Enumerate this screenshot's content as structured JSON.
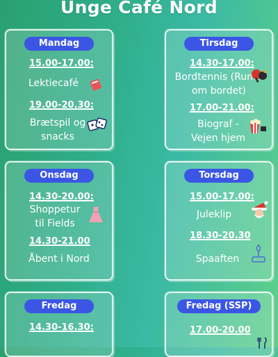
{
  "title": "Unge Café Nord",
  "days": [
    {
      "name": "Mandag",
      "entries": [
        {
          "time": "15.00-17.00:",
          "activity": "Lektiecafé",
          "icon": "book-icon"
        },
        {
          "time": "19.00-20.30:",
          "activity": "Brætspil og snacks",
          "icon": "dice-icon"
        }
      ]
    },
    {
      "name": "Tirsdag",
      "entries": [
        {
          "time": "14.30-17.00:",
          "activity": "Bordtennis (Rundt om bordet)",
          "icon": "ping-pong-icon"
        },
        {
          "time": "17.00-21.00:",
          "activity": "Biograf - Vejen hjem",
          "icon": "popcorn-icon"
        }
      ]
    },
    {
      "name": "Onsdag",
      "entries": [
        {
          "time": "14.30-20.00:",
          "activity": "Shoppetur til Fields",
          "icon": "dress-icon"
        },
        {
          "time": "14.30-21.00",
          "activity": "Åbent i Nord",
          "icon": ""
        }
      ]
    },
    {
      "name": "Torsdag",
      "entries": [
        {
          "time": "15.00-17.00:",
          "activity": "Juleklip",
          "icon": "santa-icon"
        },
        {
          "time": "18.30-20.30",
          "activity": "Spaaften",
          "icon": "spa-icon"
        }
      ]
    },
    {
      "name": "Fredag",
      "entries": [
        {
          "time": "14.30-16.30:",
          "activity": "",
          "icon": ""
        }
      ]
    },
    {
      "name": "Fredag (SSP)",
      "entries": [
        {
          "time": "17.00-20.00",
          "activity": "",
          "icon": "cutlery-icon"
        }
      ]
    }
  ]
}
